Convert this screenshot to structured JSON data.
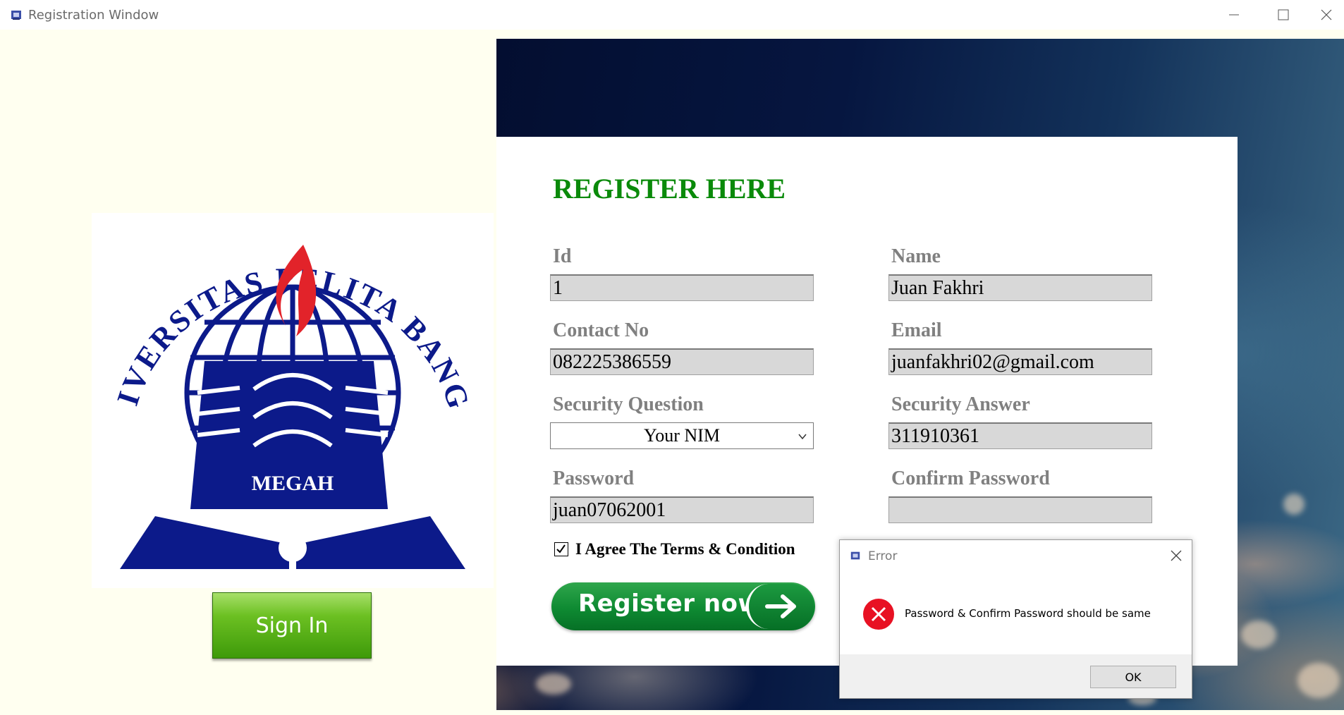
{
  "window": {
    "title": "Registration Window"
  },
  "form": {
    "heading": "REGISTER HERE",
    "fields": {
      "id": {
        "label": "Id",
        "value": "1"
      },
      "name": {
        "label": "Name",
        "value": "Juan Fakhri"
      },
      "contact": {
        "label": "Contact No",
        "value": "082225386559"
      },
      "email": {
        "label": "Email",
        "value": "juanfakhri02@gmail.com"
      },
      "question": {
        "label": "Security Question",
        "value": "Your NIM"
      },
      "answer": {
        "label": "Security Answer",
        "value": "311910361"
      },
      "password": {
        "label": "Password",
        "value": "juan07062001"
      },
      "confirm": {
        "label": "Confirm Password",
        "value": ""
      }
    },
    "agree_label": "I Agree The Terms & Condition",
    "agree_checked": true,
    "register_label": "Register now"
  },
  "logo": {
    "university": "UNIVERSITAS PELITA BANGSA",
    "motto": "MEGAH"
  },
  "signin_label": "Sign In",
  "dialog": {
    "title": "Error",
    "message": "Password & Confirm Password should be same",
    "ok_label": "OK"
  },
  "colors": {
    "heading": "#0a8a0a",
    "label": "#808080",
    "field_bg": "#d8d8d8",
    "left_bg": "#fffff0",
    "logo_blue": "#0c1a8a",
    "flame_red": "#e2232a"
  }
}
